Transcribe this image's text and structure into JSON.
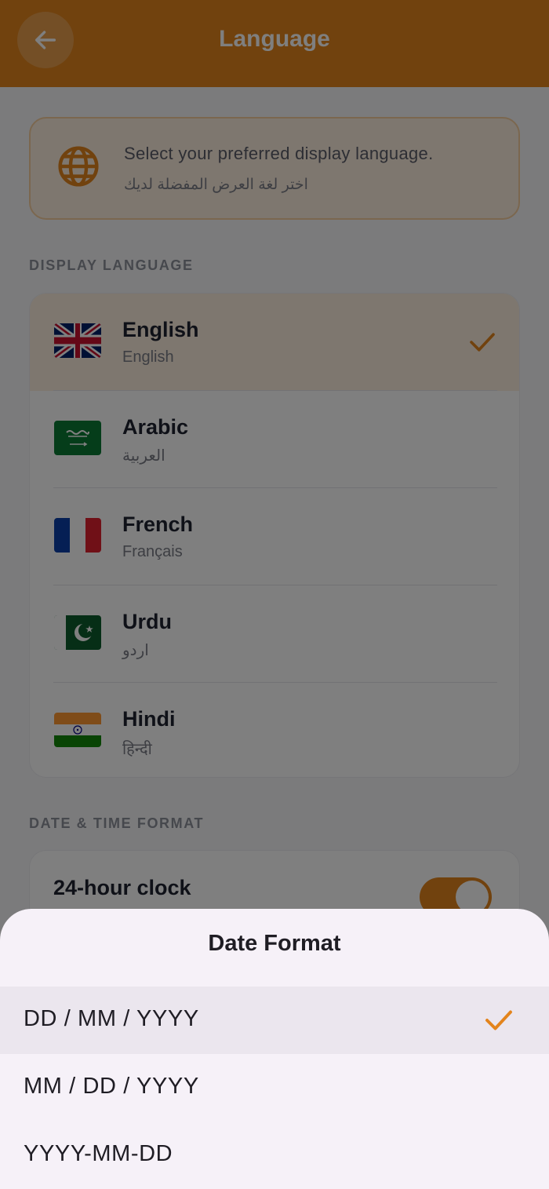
{
  "appbar": {
    "title": "Language",
    "back_icon": "arrow-left-icon"
  },
  "info": {
    "icon": "globe-icon",
    "text_en": "Select your preferred display language.",
    "text_ar": "اختر لغة العرض المفضلة لديك"
  },
  "display_language": {
    "section_label": "DISPLAY LANGUAGE",
    "items": [
      {
        "name": "English",
        "native": "English",
        "flag": "uk-flag-icon",
        "selected": true
      },
      {
        "name": "Arabic",
        "native": "العربية",
        "flag": "saudi-flag-icon",
        "selected": false
      },
      {
        "name": "French",
        "native": "Français",
        "flag": "france-flag-icon",
        "selected": false
      },
      {
        "name": "Urdu",
        "native": "اردو",
        "flag": "pakistan-flag-icon",
        "selected": false
      },
      {
        "name": "Hindi",
        "native": "हिन्दी",
        "flag": "india-flag-icon",
        "selected": false
      }
    ]
  },
  "date_time": {
    "section_label": "DATE & TIME FORMAT",
    "clock_label": "24-hour clock",
    "clock_enabled": true
  },
  "sheet": {
    "title": "Date Format",
    "options": [
      {
        "label": "DD / MM / YYYY",
        "selected": true
      },
      {
        "label": "MM / DD / YYYY",
        "selected": false
      },
      {
        "label": "YYYY-MM-DD",
        "selected": false
      }
    ]
  },
  "colors": {
    "accent": "#e3841c",
    "accent_light": "#fdeede",
    "sheet_bg": "#f6f1f8",
    "scrim": "rgba(0,0,0,0.5)"
  }
}
